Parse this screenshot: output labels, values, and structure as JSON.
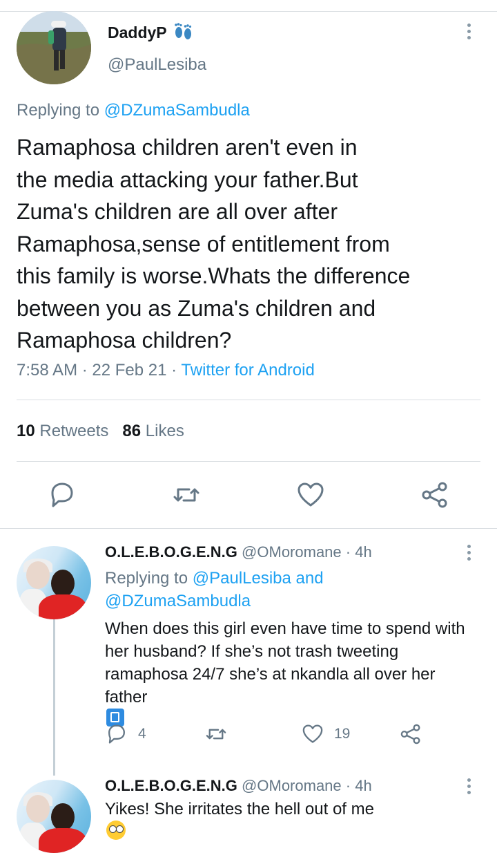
{
  "main_tweet": {
    "display_name": "DaddyP",
    "handle": "@PaulLesiba",
    "replying_prefix": "Replying to",
    "replying_to": "@DZumaSambudla",
    "text_lines": [
      "Ramaphosa children aren't even in",
      "the media attacking your father.But",
      "Zuma's children are all over after",
      "Ramaphosa,sense of entitlement from",
      "this family is worse.Whats the difference",
      "between you as Zuma's children and",
      "Ramaphosa children?"
    ],
    "time": "7:58 AM",
    "date": "22 Feb 21",
    "source": "Twitter for Android",
    "retweets_count": "10",
    "retweets_label": "Retweets",
    "likes_count": "86",
    "likes_label": "Likes"
  },
  "replies": [
    {
      "name": "O.L.E.B.O.G.E.N.G",
      "handle": "@OMoromane",
      "age": "4h",
      "replying_prefix": "Replying to",
      "replying_to_1": "@PaulLesiba",
      "replying_and": "and",
      "replying_to_2": "@DZumaSambudla",
      "text_lines": [
        "When does this girl even have time to spend with",
        "her husband? If she’s not trash tweeting",
        "ramaphosa 24/7 she’s at nkandla all over her",
        "father"
      ],
      "reply_count": "4",
      "like_count": "19"
    },
    {
      "name": "O.L.E.B.O.G.E.N.G",
      "handle": "@OMoromane",
      "age": "4h",
      "text": "Yikes! She irritates the hell out of me"
    }
  ],
  "separator": "·",
  "colors": {
    "accent": "#1da1f2",
    "muted": "#657786",
    "text": "#14171a",
    "divider": "#d9dde1"
  }
}
